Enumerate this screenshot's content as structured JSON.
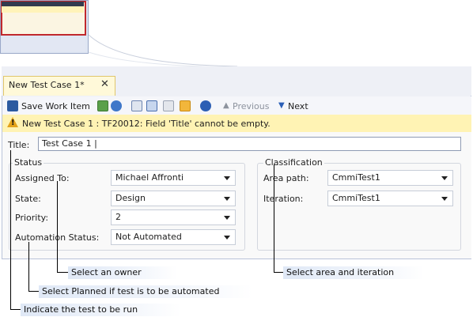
{
  "tab": {
    "title": "New Test Case 1*",
    "close_glyph": "✕"
  },
  "toolbar": {
    "save_label": "Save Work Item",
    "previous_label": "Previous",
    "next_label": "Next"
  },
  "warning": {
    "message": "New Test Case 1 : TF20012: Field 'Title' cannot be empty."
  },
  "form": {
    "title_label": "Title:",
    "title_value": "Test Case 1 |",
    "status": {
      "heading": "Status",
      "assigned_label": "Assigned To:",
      "assigned_value": "Michael Affronti",
      "state_label": "State:",
      "state_value": "Design",
      "priority_label": "Priority:",
      "priority_value": "2",
      "automation_label": "Automation Status:",
      "automation_value": "Not Automated"
    },
    "classification": {
      "heading": "Classification",
      "area_label": "Area path:",
      "area_value": "CmmiTest1",
      "iteration_label": "Iteration:",
      "iteration_value": "CmmiTest1"
    }
  },
  "callouts": {
    "owner": "Select an owner",
    "area": "Select area and iteration",
    "planned": "Select Planned if test is to be automated",
    "test": "Indicate the test to be run"
  },
  "colors": {
    "warning_bg": "#fff3b4",
    "tab_bg": "#fff9d9",
    "panel_bg": "#eef0f6",
    "thumb_highlight": "#c0282d"
  },
  "icons": [
    "save-icon",
    "refresh-icon",
    "undo-icon",
    "link-icon",
    "copy-icon",
    "attach-icon",
    "check-icon",
    "help-icon",
    "up-arrow-icon",
    "down-arrow-icon",
    "warning-icon"
  ]
}
